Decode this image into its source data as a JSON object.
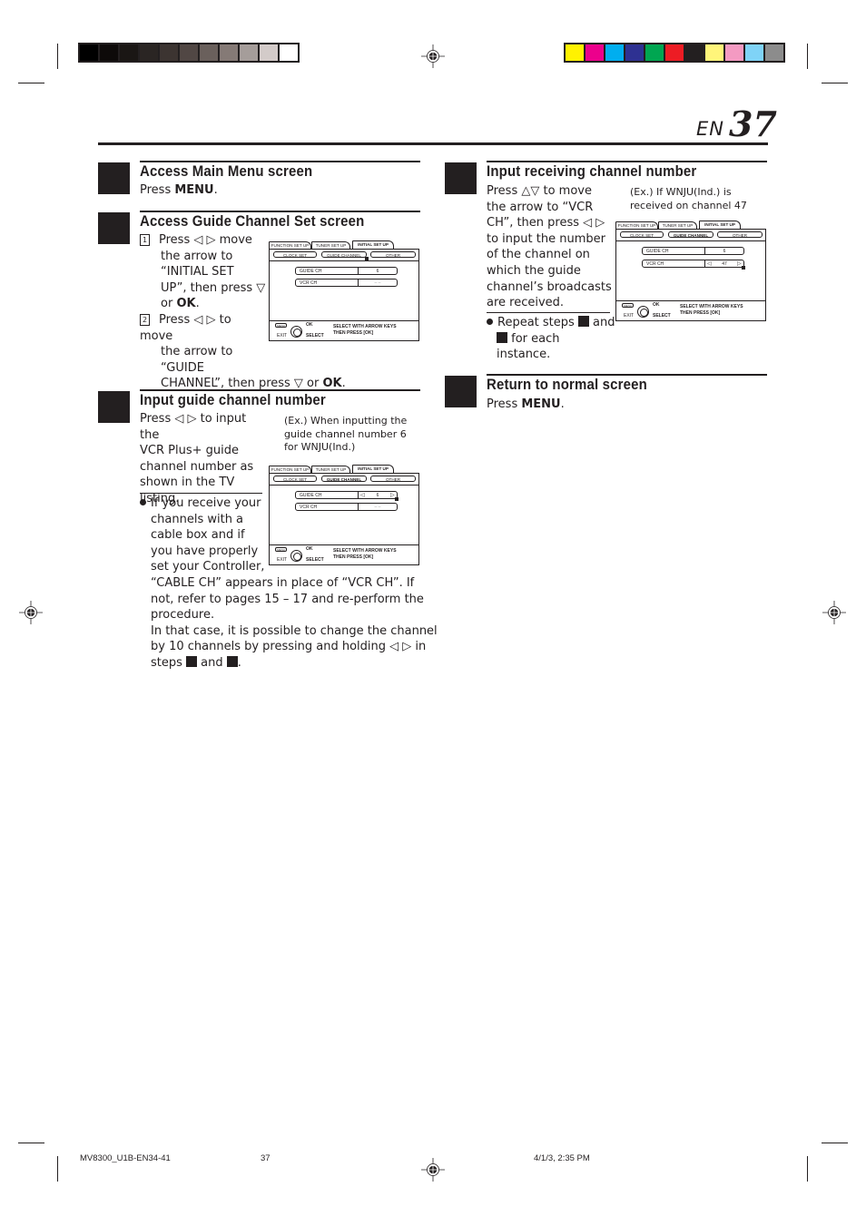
{
  "color_bars": {
    "grayscale": [
      "#000000",
      "#0d0a09",
      "#1a1614",
      "#2a2523",
      "#3c3431",
      "#514744",
      "#6a605c",
      "#857a76",
      "#a59d9a",
      "#d3cbc9",
      "#ffffff"
    ],
    "process": [
      "#fff200",
      "#ec008c",
      "#00aeef",
      "#2e3192",
      "#00a651",
      "#ed1c24",
      "#231f20",
      "#fff57a",
      "#f49ac2",
      "#7fd3f7",
      "#8c8c8c"
    ]
  },
  "header": {
    "lang_label": "EN",
    "page_number": "37"
  },
  "steps": {
    "main_menu": {
      "title": "Access Main Menu screen",
      "text_pre": "Press ",
      "text_bold": "MENU",
      "text_post": "."
    },
    "guide_set": {
      "title": "Access Guide Channel Set screen",
      "item1_num": "1",
      "item1_lines": [
        "Press ◁ ▷ move",
        "the arrow to",
        "“INITIAL SET",
        "UP”, then press ▽"
      ],
      "item1_tail_pre": "or ",
      "item1_tail_bold": "OK",
      "item1_tail_post": ".",
      "item2_num": "2",
      "item2_lines": [
        "Press ◁ ▷ to move",
        "the arrow to",
        "“GUIDE"
      ],
      "item2_tail_pre": "CHANNEL”, then press ▽ or ",
      "item2_tail_bold": "OK",
      "item2_tail_post": "."
    },
    "guide_input": {
      "title": "Input guide channel number",
      "text_lines": [
        "Press ◁ ▷ to input the",
        "VCR Plus+ guide",
        "channel number as",
        "shown in the TV",
        "listing."
      ],
      "example": [
        "(Ex.) When inputting the",
        "guide channel number 6",
        "for WNJU(Ind.)"
      ],
      "bullet_lines": [
        "If you receive your",
        "channels with a",
        "cable box and if",
        "you have properly",
        "set your Controller,"
      ],
      "bullet_wide": [
        "“CABLE CH” appears in place of “VCR CH”. If",
        "not, refer to pages 15 – 17 and re-perform the",
        "procedure.",
        "In that case, it is possible to change the channel",
        "by 10 channels by pressing and holding ◁ ▷ in"
      ],
      "bullet_last_pre": "steps ",
      "bullet_last_mid": " and ",
      "bullet_last_post": "."
    },
    "receive_input": {
      "title": "Input receiving channel number",
      "text_lines": [
        "Press △▽ to move",
        "the arrow to “VCR",
        "CH”, then press ◁ ▷",
        "to input the number",
        "of the channel on",
        "which the guide",
        "channel’s broadcasts",
        "are received."
      ],
      "example": [
        "(Ex.) If WNJU(Ind.) is",
        "received on channel 47"
      ],
      "bullet_pre": "Repeat steps ",
      "bullet_mid": " and",
      "bullet_line2": " for each",
      "bullet_line3": "instance."
    },
    "return": {
      "title": "Return to normal screen",
      "text_pre": "Press ",
      "text_bold": "MENU",
      "text_post": "."
    }
  },
  "osd": {
    "tabs": [
      "FUNCTION SET UP",
      "TUNER SET UP",
      "INITIAL SET UP"
    ],
    "subtabs": [
      "CLOCK SET",
      "GUIDE CHANNEL",
      "OTHER"
    ],
    "row_guide_label": "GUIDE CH",
    "row_vcr_label": "VCR CH",
    "menu_key": "MENU",
    "exit": "EXIT",
    "ok": "OK",
    "select": "SELECT",
    "instr1": "SELECT WITH ARROW KEYS",
    "instr2": "THEN PRESS [OK]",
    "left_arrow": "◁",
    "right_arrow": "▷",
    "screen1": {
      "guide_value": "6",
      "vcr_value": "– –"
    },
    "screen2": {
      "guide_value": "6",
      "vcr_value": "– –"
    },
    "screen3": {
      "guide_value": "6",
      "vcr_value": "47"
    }
  },
  "footer": {
    "file": "MV8300_U1B-EN34-41",
    "page": "37",
    "timestamp": "4/1/3, 2:35 PM"
  }
}
